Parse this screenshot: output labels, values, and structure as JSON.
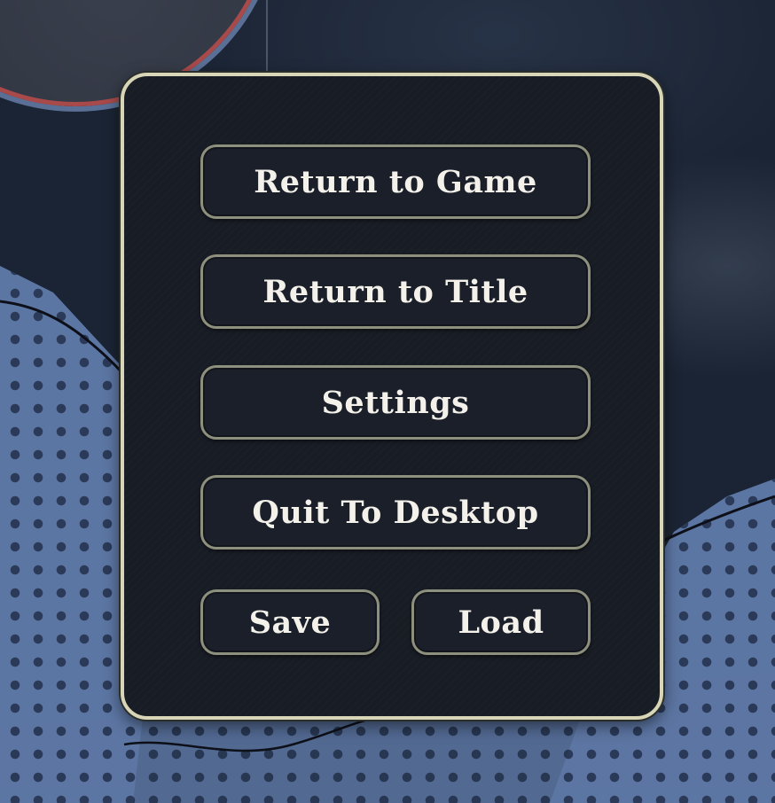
{
  "pause_menu": {
    "buttons": {
      "return_to_game": "Return to Game",
      "return_to_title": "Return to Title",
      "settings": "Settings",
      "quit_to_desktop": "Quit To Desktop",
      "save": "Save",
      "load": "Load"
    }
  },
  "colors": {
    "panel_border": "#d9d6b8",
    "panel_background": "#181c24",
    "button_border": "#8e907e",
    "button_text": "#f3f1ea",
    "map_sea": "#5c76a3",
    "map_land": "#1b2434"
  }
}
